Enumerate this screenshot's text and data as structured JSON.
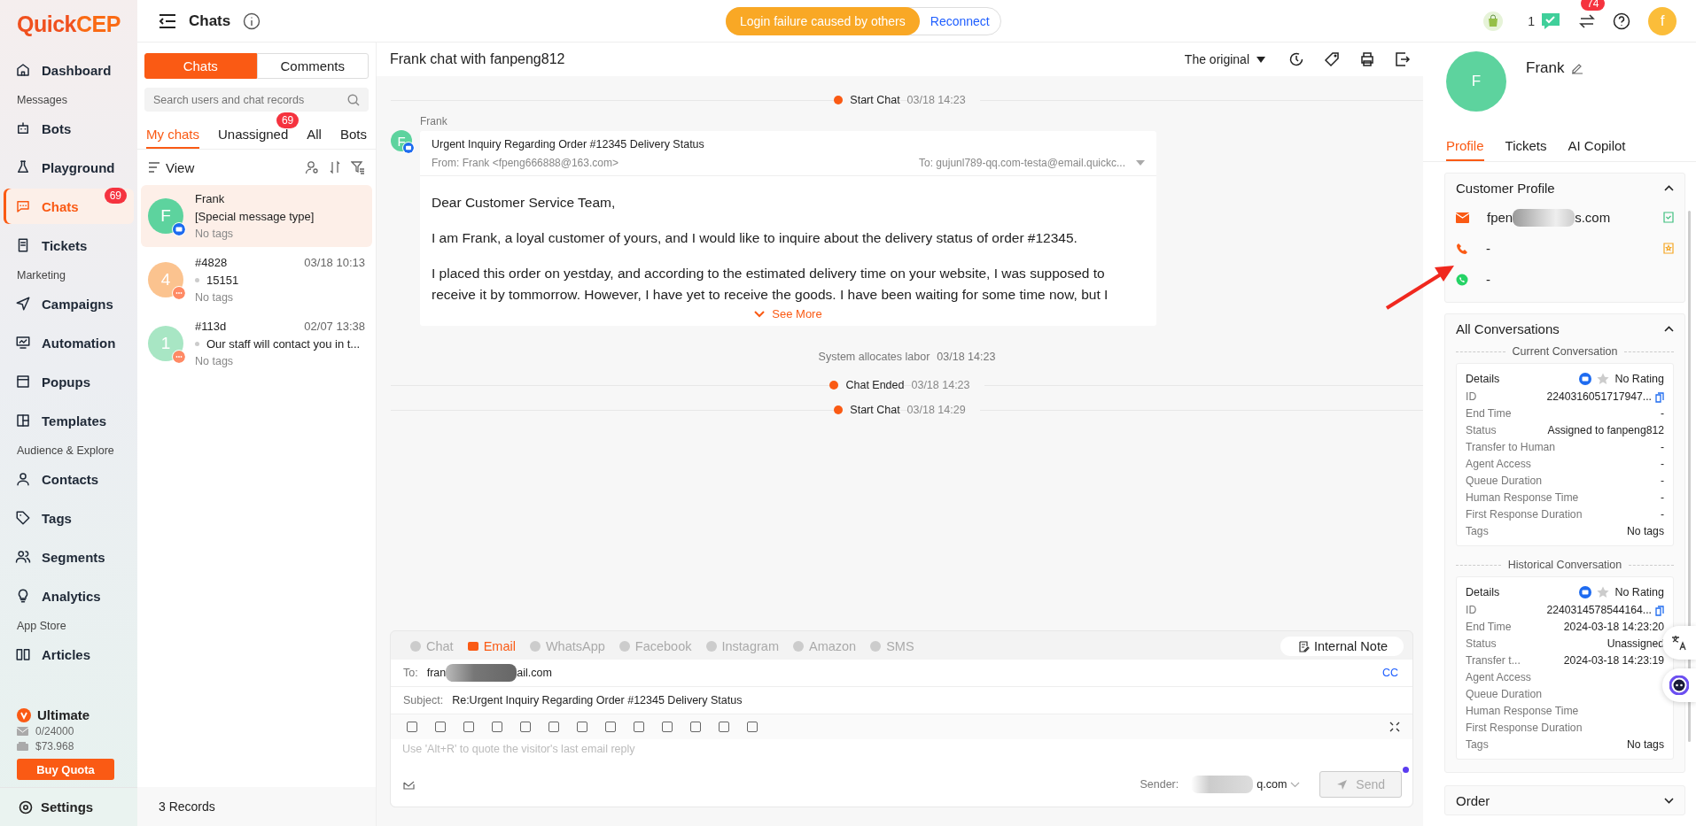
{
  "logo": {
    "first": "Quick",
    "second": "CEP"
  },
  "topbar": {
    "title": "Chats",
    "alert": "Login failure caused by others",
    "alert_action": "Reconnect",
    "counter": "1",
    "notification_badge": "74",
    "user_initial": "f"
  },
  "sidebar": {
    "items": [
      {
        "kind": "item",
        "label": "Dashboard",
        "selected": false
      },
      {
        "kind": "section",
        "label": "Messages"
      },
      {
        "kind": "item",
        "label": "Bots",
        "selected": false
      },
      {
        "kind": "item",
        "label": "Playground",
        "selected": false
      },
      {
        "kind": "item",
        "label": "Chats",
        "selected": true,
        "badge": "69"
      },
      {
        "kind": "item",
        "label": "Tickets",
        "selected": false
      },
      {
        "kind": "section",
        "label": "Marketing"
      },
      {
        "kind": "item",
        "label": "Campaigns",
        "selected": false
      },
      {
        "kind": "item",
        "label": "Automation",
        "selected": false
      },
      {
        "kind": "item",
        "label": "Popups",
        "selected": false
      },
      {
        "kind": "item",
        "label": "Templates",
        "selected": false
      },
      {
        "kind": "section",
        "label": "Audience & Explore"
      },
      {
        "kind": "item",
        "label": "Contacts",
        "selected": false
      },
      {
        "kind": "item",
        "label": "Tags",
        "selected": false
      },
      {
        "kind": "item",
        "label": "Segments",
        "selected": false
      },
      {
        "kind": "item",
        "label": "Analytics",
        "selected": false
      },
      {
        "kind": "section",
        "label": "App Store"
      },
      {
        "kind": "item",
        "label": "Articles",
        "selected": false
      }
    ],
    "plan": {
      "name": "Ultimate",
      "quota": "0/24000",
      "balance": "$73.968",
      "button": "Buy Quota"
    },
    "settings": "Settings"
  },
  "chat_list": {
    "tabs": [
      {
        "label": "Chats",
        "selected": true
      },
      {
        "label": "Comments",
        "selected": false
      }
    ],
    "search": {
      "placeholder": "Search users and chat records"
    },
    "filters": [
      {
        "label": "My chats",
        "selected": true
      },
      {
        "label": "Unassigned",
        "selected": false,
        "badge": "69"
      },
      {
        "label": "All",
        "selected": false
      },
      {
        "label": "Bots",
        "selected": false
      }
    ],
    "view": "View",
    "items": [
      {
        "initial": "F",
        "color": "#5dd39e",
        "kind": "email",
        "name": "Frank",
        "preview": "[Special message type]",
        "unread_dot": false,
        "tags": "No tags",
        "selected": true
      },
      {
        "initial": "4",
        "color": "#fbc38f",
        "kind": "chat",
        "name": "#4828",
        "time": "03/18 10:13",
        "preview": "15151",
        "unread_dot": true,
        "tags": "No tags",
        "selected": false
      },
      {
        "initial": "1",
        "color": "#a8e6c4",
        "kind": "chat",
        "name": "#113d",
        "time": "02/07 13:38",
        "preview": "Our staff will contact you in t...",
        "unread_dot": true,
        "tags": "No tags",
        "selected": false
      }
    ],
    "records": "3 Records"
  },
  "conversation": {
    "title": "Frank chat with fanpeng812",
    "view_mode": "The original",
    "timeline": [
      {
        "kind": "event",
        "text": "Start Chat",
        "time": "03/18 14:23"
      },
      {
        "kind": "email",
        "sender": "Frank",
        "initial": "F",
        "subject": "Urgent Inquiry Regarding Order #12345 Delivery Status",
        "from": "From: Frank <fpeng666888@163.com>",
        "to": "To: gujunl789-qq.com-testa@email.quickc...",
        "paragraphs": [
          "Dear Customer Service Team,",
          "I am Frank, a loyal customer of yours, and I would like to inquire about the delivery status of order #12345.",
          "I placed this order on yestday, and according to the estimated delivery time on your website, I was supposed to receive it by tommorrow. However, I have yet to receive the goods. I have been waiting for some time now, but I"
        ],
        "more": "See More"
      },
      {
        "kind": "system",
        "text": "System allocates labor",
        "time": "03/18 14:23"
      },
      {
        "kind": "event",
        "text": "Chat Ended",
        "time": "03/18 14:23"
      },
      {
        "kind": "event",
        "text": "Start Chat",
        "time": "03/18 14:29"
      }
    ]
  },
  "composer": {
    "channels": [
      {
        "label": "Chat",
        "selected": false
      },
      {
        "label": "Email",
        "selected": true
      },
      {
        "label": "WhatsApp",
        "selected": false
      },
      {
        "label": "Facebook",
        "selected": false
      },
      {
        "label": "Instagram",
        "selected": false
      },
      {
        "label": "Amazon",
        "selected": false
      },
      {
        "label": "SMS",
        "selected": false
      }
    ],
    "internal_note": "Internal Note",
    "to_label": "To:",
    "to_prefix": "fran",
    "to_suffix": "ail.com",
    "cc": "CC",
    "subject_label": "Subject:",
    "subject": "Re:Urgent Inquiry Regarding Order #12345 Delivery Status",
    "placeholder": "Use 'Alt+R' to quote the visitor's last email reply",
    "sender_label": "Sender:",
    "sender_suffix": "q.com",
    "send": "Send",
    "send_disabled": true
  },
  "profile": {
    "initial": "F",
    "name": "Frank",
    "tabs": [
      {
        "label": "Profile",
        "selected": true
      },
      {
        "label": "Tickets",
        "selected": false
      },
      {
        "label": "AI Copilot",
        "selected": false
      }
    ],
    "customer_profile": {
      "title": "Customer Profile",
      "email_prefix": "fpen",
      "email_suffix": "s.com",
      "phone": "-",
      "whatsapp": "-"
    },
    "conversations": {
      "title": "All Conversations",
      "groups": [
        {
          "heading": "Current Conversation",
          "details": "Details",
          "rating": "No Rating",
          "rows": [
            {
              "label": "ID",
              "value": "2240316051717947...",
              "copy": true
            },
            {
              "label": "End Time",
              "value": "-"
            },
            {
              "label": "Status",
              "value": "Assigned to fanpeng812"
            },
            {
              "label": "Transfer to Human",
              "value": "-"
            },
            {
              "label": "Agent Access",
              "value": "-"
            },
            {
              "label": "Queue Duration",
              "value": "-"
            },
            {
              "label": "Human Response Time",
              "value": "-"
            },
            {
              "label": "First Response Duration",
              "value": "-"
            },
            {
              "label": "Tags",
              "value": "No tags"
            }
          ]
        },
        {
          "heading": "Historical Conversation",
          "details": "Details",
          "rating": "No Rating",
          "rows": [
            {
              "label": "ID",
              "value": "2240314578544164...",
              "copy": true
            },
            {
              "label": "End Time",
              "value": "2024-03-18 14:23:20"
            },
            {
              "label": "Status",
              "value": "Unassigned"
            },
            {
              "label": "Transfer t...",
              "value": "2024-03-18 14:23:19"
            },
            {
              "label": "Agent Access"
            },
            {
              "label": "Queue Duration"
            },
            {
              "label": "Human Response Time"
            },
            {
              "label": "First Response Duration"
            },
            {
              "label": "Tags",
              "value": "No tags"
            }
          ]
        }
      ]
    },
    "order": "Order"
  }
}
